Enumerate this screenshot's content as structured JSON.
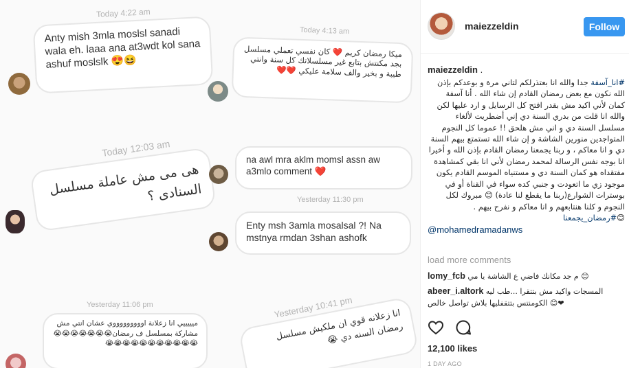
{
  "collage": {
    "bubbles": [
      {
        "timestamp": "Today 4:22 am",
        "text": "Anty mish 3mla moslsl sanadi wala eh. laaa ana at3wdt kol sana ashuf moslslk 😍😆"
      },
      {
        "timestamp": "Today 4:13 am",
        "text": "ميكا رمضان كريم ❤️ كان نفسي تعملي مسلسل بجد مكنتش بتابع غير مسلسلاتك كل سنة وانتي طيبة و بخير والف سلامة عليكي ❤️❤️"
      },
      {
        "timestamp": "Today 12:03 am",
        "text": "هى مى مش عاملة مسلسل السنادى ؟"
      },
      {
        "timestamp": "",
        "text": "na awl mra aklm momsl assn aw a3mlo comment ❤️"
      },
      {
        "timestamp": "Yesterday 11:30 pm",
        "text": "Enty msh 3amla mosalsal ?! Na mstnya rmdan 3shan ashofk"
      },
      {
        "timestamp": "Yesterday 11:06 pm",
        "text": "ميييييي انا زعلانة اوووووووووي عشان انتي مش مشاركة بمسلسل ف رمضان😭😭😭😭😭😭😭😭😭😭😭😭😭😭😭😭😭😭"
      },
      {
        "timestamp": "Yesterday 10:41 pm",
        "text": "انا زعلانه قوي ان ملكيش مسلسل رمضان السنه دي 😭"
      }
    ]
  },
  "post": {
    "username": "maiezzeldin",
    "follow_label": "Follow",
    "caption_author": "maiezzeldin",
    "caption_tag_start": "#انا_آسفة",
    "caption_body": " جدا والله انا بعتذرلكم لتاني مرة و بوعدكم بإذن الله نكون مع بعض رمضان القادم إن شاء الله . أنا آسفة كمان لأني اكيد مش بقدر افتح كل الرسايل و ارد عليها لكن والله انا قلت من بدري السنة دي إني أضطريت لألغاء مسلسل السنة دي و اني مش هلحق !! عموما كل النجوم المتواجدين منورين الشاشة و إن شاء الله تستمتع بيهم السنة دي و انا معاكم ، و ربنا يجمعنا رمضان القادم بإذن الله و أخيرا انا بوجه نفس الرسالة لمحمد رمضان لأني انا بقي كمشاهدة مفتقداه هو كمان السنة دي و مستنياه الموسم القادم يكون موجود زي ما اتعودت و جنبي كده سواء في القناة أو في بوسترات الشوارع(ربنا ما يقطع لنا عادة) 😊 مبروك لكل النجوم و كلنا هنتابعهم و انا معاكم و نفرح بيهم . ",
    "caption_tag_end": "#رمضان_يجمعنا",
    "caption_emoji": "😊",
    "mention": "@mohamedramadanws",
    "load_more": "load more comments",
    "comments": [
      {
        "user": "lomy_fcb",
        "text": "م جد مكانك فاضي ع الشاشة يا مي 😊"
      },
      {
        "user": "abeer_i.altork",
        "text": "المسجات واكيد مش بتتقرا ...طب ليه الكومنتس بتتقفليها بلاش تواصل خالص 😊❤"
      }
    ],
    "likes": "12,100 likes",
    "time_ago": "1 DAY AGO"
  },
  "icons": {
    "like": "heart-icon",
    "comment": "speech-bubble-icon"
  },
  "colors": {
    "follow_blue": "#3897f0",
    "link_navy": "#003569",
    "muted_gray": "#999999"
  }
}
